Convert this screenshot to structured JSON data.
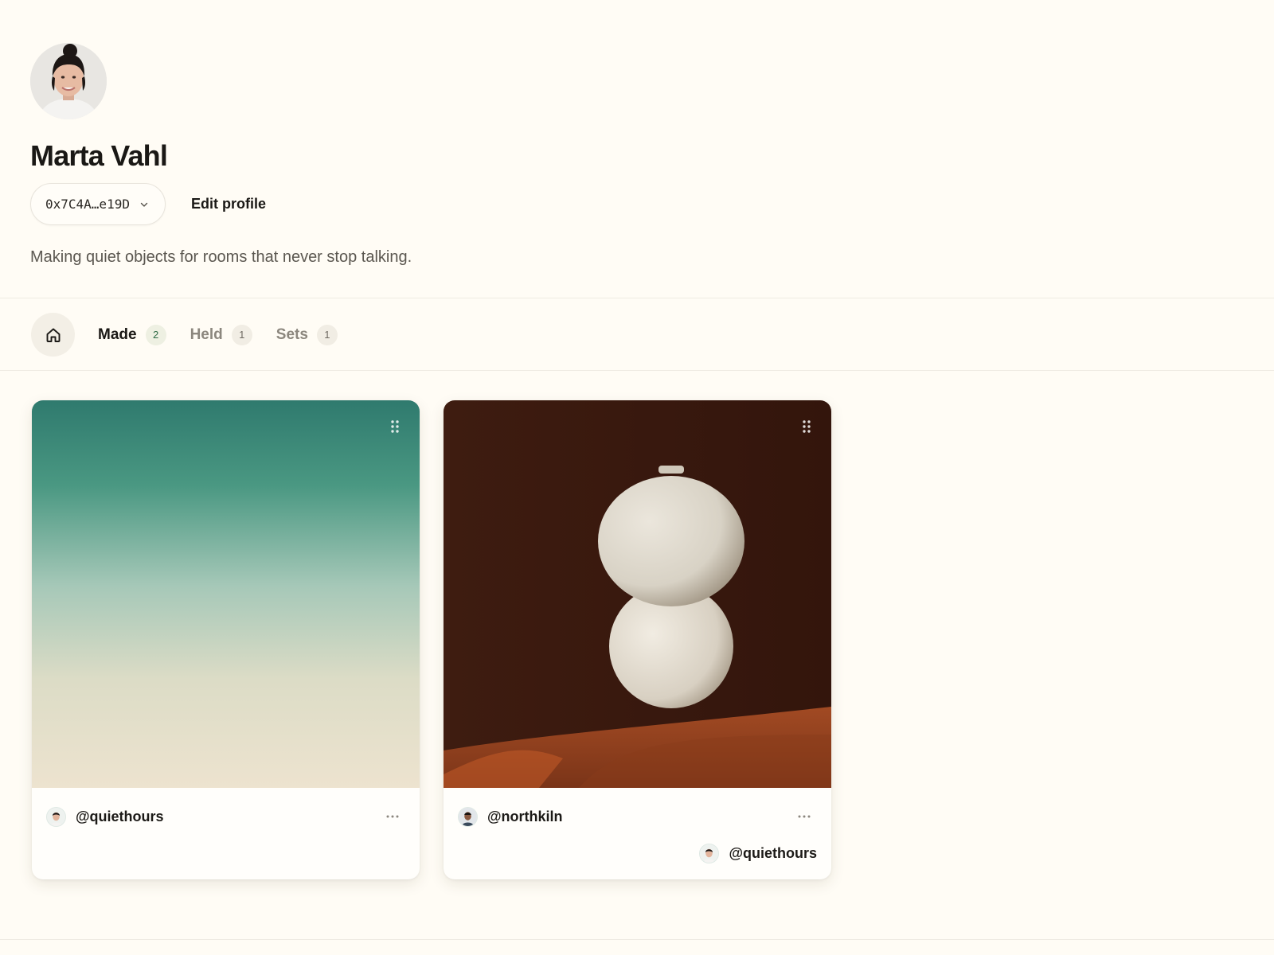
{
  "profile": {
    "name": "Marta Vahl",
    "wallet_address": "0x7C4A…e19D",
    "edit_label": "Edit profile",
    "bio": "Making quiet objects for rooms that never stop talking."
  },
  "tabs": [
    {
      "label": "Made",
      "count": "2",
      "active": true
    },
    {
      "label": "Held",
      "count": "1",
      "active": false
    },
    {
      "label": "Sets",
      "count": "1",
      "active": false
    }
  ],
  "cards": [
    {
      "artwork": "teal-to-sand gradient",
      "creator": "@quiethours",
      "holder": ""
    },
    {
      "artwork": "stacked white ceramic vessel on dark background",
      "creator": "@northkiln",
      "holder": "@quiethours"
    }
  ],
  "icons": {
    "home": "home-icon",
    "wallet_chevron": "chevron-down-icon",
    "drag": "drag-handle-icon",
    "more": "more-horizontal-icon"
  },
  "colors": {
    "background": "#fffcf5",
    "accent_badge": "#2e6b45",
    "gradient_top": "#2f7a6e",
    "gradient_bottom": "#ede3cf",
    "vessel_bg": "#3a1a0f"
  }
}
